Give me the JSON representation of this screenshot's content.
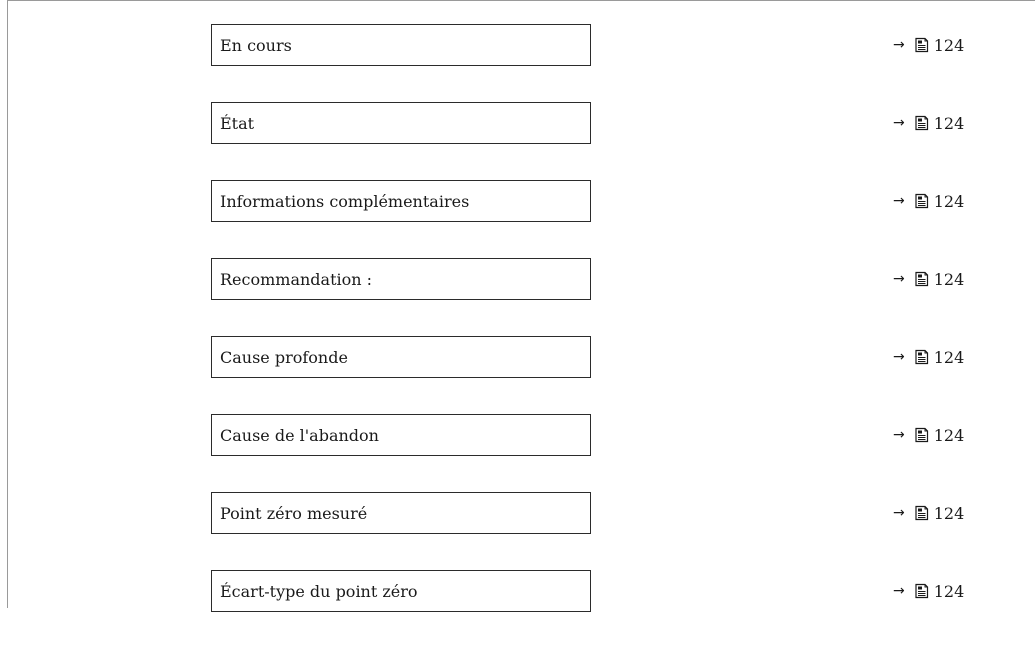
{
  "parameters": [
    {
      "label": "En cours",
      "arrow": "→",
      "page": "124"
    },
    {
      "label": "État",
      "arrow": "→",
      "page": "124"
    },
    {
      "label": "Informations complémentaires",
      "arrow": "→",
      "page": "124"
    },
    {
      "label": "Recommandation :",
      "arrow": "→",
      "page": "124"
    },
    {
      "label": "Cause profonde",
      "arrow": "→",
      "page": "124"
    },
    {
      "label": "Cause de l'abandon",
      "arrow": "→",
      "page": "124"
    },
    {
      "label": "Point zéro mesuré",
      "arrow": "→",
      "page": "124"
    },
    {
      "label": "Écart-type du point zéro",
      "arrow": "→",
      "page": "124"
    }
  ],
  "icons": {
    "reference": "book-page-icon",
    "arrow": "right-arrow-icon"
  }
}
